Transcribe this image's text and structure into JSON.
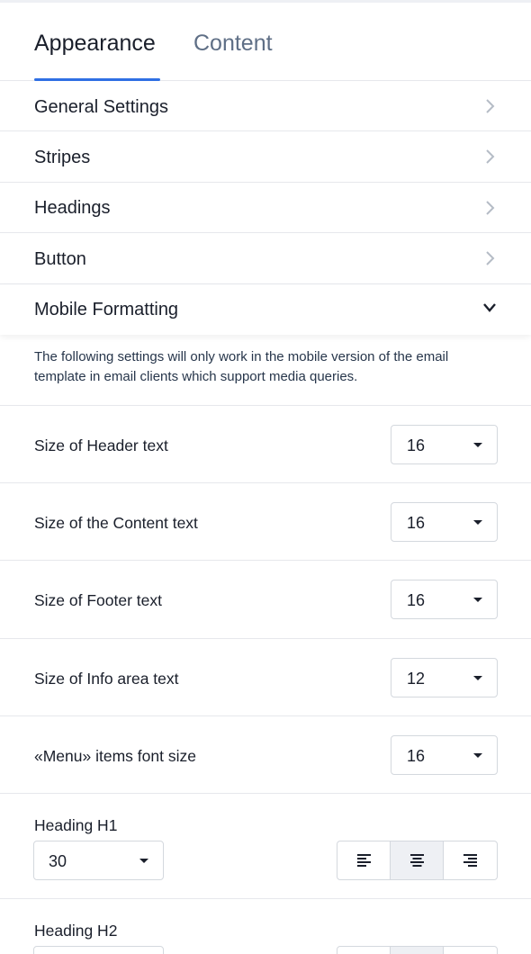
{
  "tabs": [
    {
      "label": "Appearance",
      "active": true
    },
    {
      "label": "Content",
      "active": false
    }
  ],
  "sections": [
    {
      "label": "General Settings",
      "expanded": false
    },
    {
      "label": "Stripes",
      "expanded": false
    },
    {
      "label": "Headings",
      "expanded": false
    },
    {
      "label": "Button",
      "expanded": false
    },
    {
      "label": "Mobile Formatting",
      "expanded": true
    }
  ],
  "mobile_formatting": {
    "note": "The following settings will only work in the mobile version of the email template in email clients which support media queries.",
    "settings": [
      {
        "label": "Size of Header text",
        "value": "16"
      },
      {
        "label": "Size of the Content text",
        "value": "16"
      },
      {
        "label": "Size of Footer text",
        "value": "16"
      },
      {
        "label": "Size of Info area text",
        "value": "12"
      },
      {
        "label": "«Menu» items font size",
        "value": "16"
      }
    ],
    "headings": [
      {
        "label": "Heading H1",
        "size": "30",
        "alignment": "center"
      },
      {
        "label": "Heading H2",
        "size": "",
        "alignment": "center"
      }
    ]
  },
  "icons": {
    "section_collapsed": "chevron-right-icon",
    "section_expanded": "chevron-down-icon",
    "select_caret": "caret-down-icon",
    "align": [
      "align-left-icon",
      "align-center-icon",
      "align-right-icon"
    ]
  },
  "colors": {
    "accent": "#2f6fe4",
    "inactive_tab": "#5f6f86",
    "text": "#1a1f2b",
    "border": "#d4d8de",
    "active_align_bg": "#eef0f4"
  }
}
